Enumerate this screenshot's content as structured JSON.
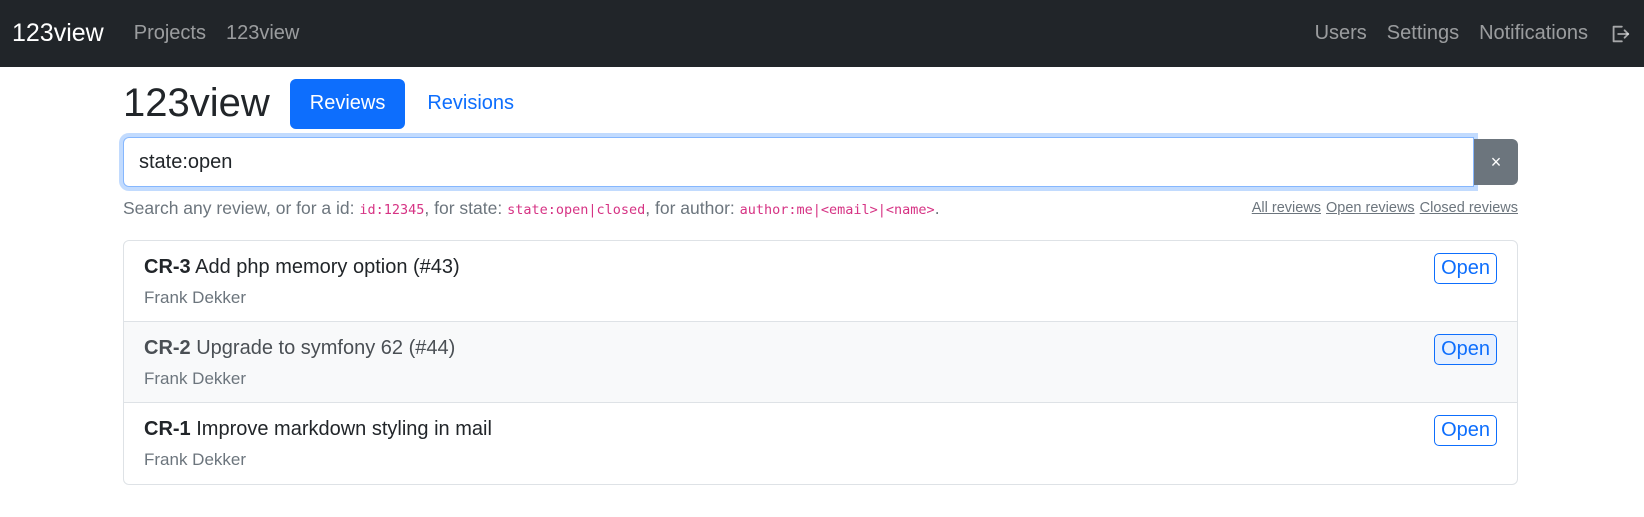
{
  "navbar": {
    "brand": "123view",
    "left_links": [
      "Projects",
      "123view"
    ],
    "right_links": [
      "Users",
      "Settings",
      "Notifications"
    ],
    "logout_icon": "logout-icon"
  },
  "page": {
    "title": "123view",
    "tabs": [
      {
        "label": "Reviews",
        "active": true
      },
      {
        "label": "Revisions",
        "active": false
      }
    ]
  },
  "search": {
    "value": "state:open",
    "clear_label": "×",
    "help": {
      "prefix": "Search any review, or for a id: ",
      "id_example": "id:12345",
      "state_text": ", for state: ",
      "state_example": "state:open|closed",
      "author_text": ", for author: ",
      "author_example": "author:me|<email>|<name>",
      "suffix": "."
    },
    "filters": [
      "All reviews",
      "Open reviews",
      "Closed reviews"
    ]
  },
  "reviews": [
    {
      "id": "CR-3",
      "title": "Add php memory option (#43)",
      "author": "Frank Dekker",
      "status": "Open"
    },
    {
      "id": "CR-2",
      "title": "Upgrade to symfony 62 (#44)",
      "author": "Frank Dekker",
      "status": "Open"
    },
    {
      "id": "CR-1",
      "title": "Improve markdown styling in mail",
      "author": "Frank Dekker",
      "status": "Open"
    }
  ],
  "colors": {
    "navbar_bg": "#212529",
    "primary": "#0d6efd",
    "muted": "#6c757d",
    "code": "#d63384"
  }
}
